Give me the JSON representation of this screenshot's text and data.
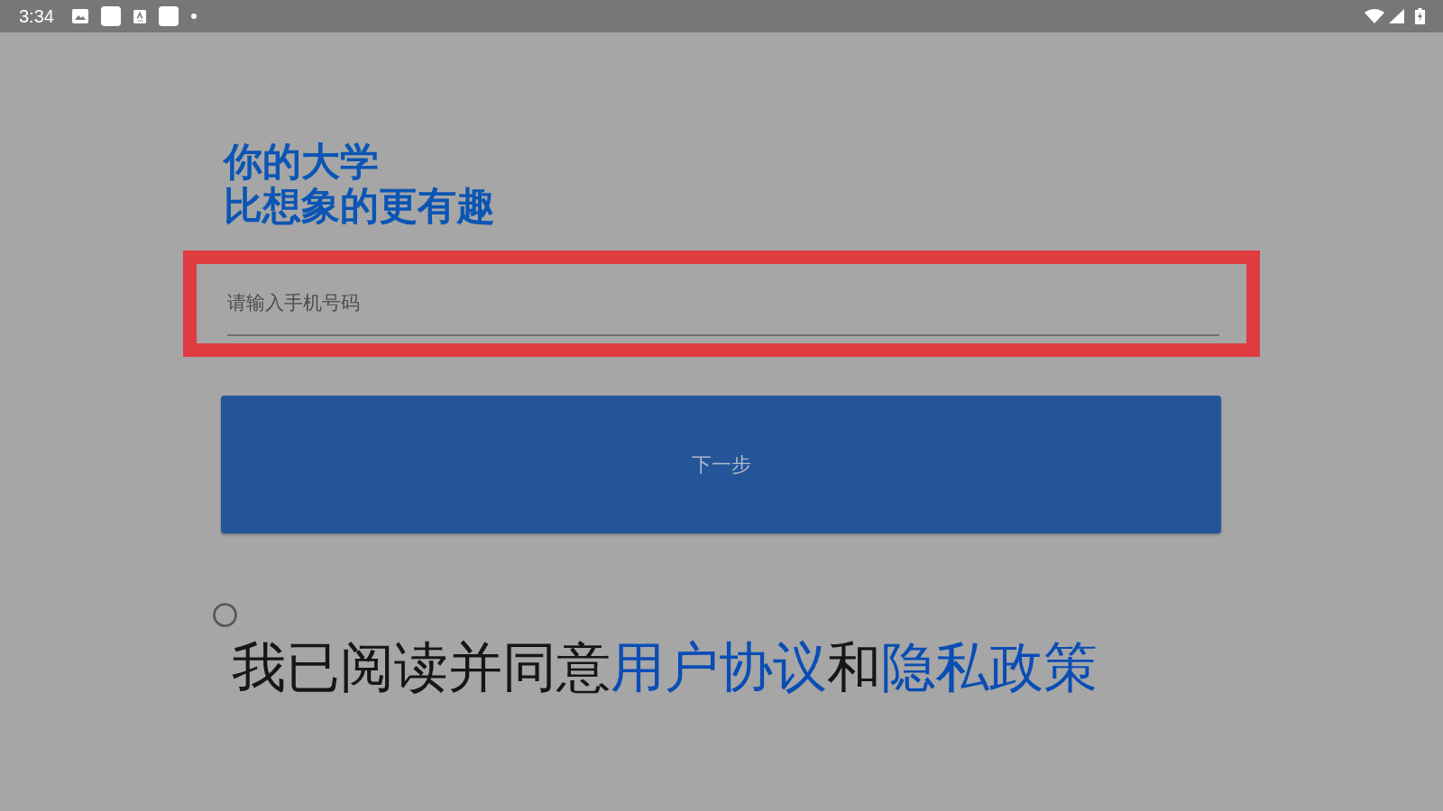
{
  "status_bar": {
    "time": "3:34"
  },
  "heading": {
    "lines": [
      "你的大学",
      "比想象的更有趣"
    ]
  },
  "phone_field": {
    "placeholder": "请输入手机号码",
    "highlighted": true
  },
  "next_button": {
    "label": "下一步"
  },
  "agreement": {
    "checked": false,
    "parts": [
      {
        "kind": "text",
        "text": "我已阅读并同意"
      },
      {
        "kind": "link",
        "text": "用户协议"
      },
      {
        "kind": "text",
        "text": "和"
      },
      {
        "kind": "link",
        "text": "隐私政策"
      }
    ]
  }
}
